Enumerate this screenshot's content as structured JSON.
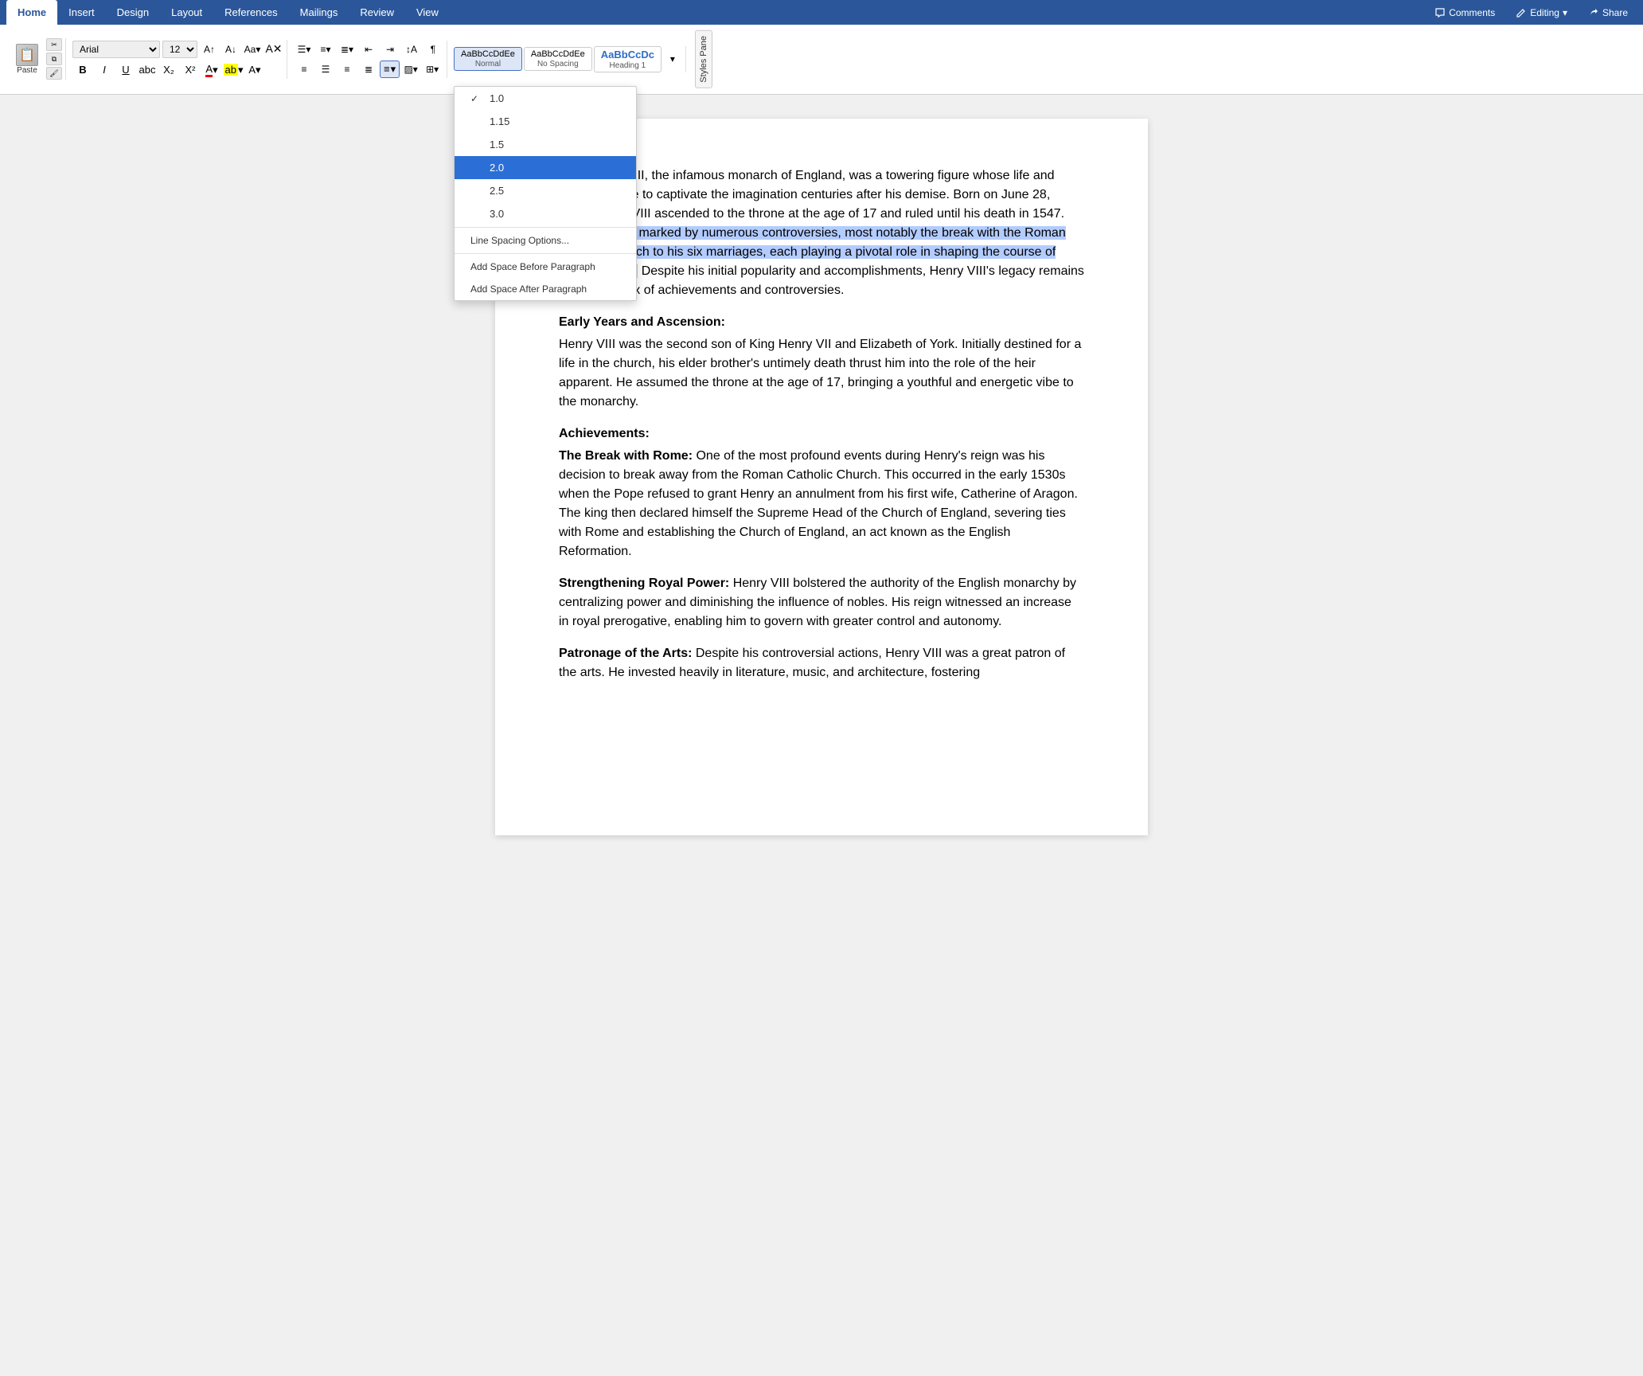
{
  "tabs": {
    "items": [
      {
        "label": "Home",
        "active": true
      },
      {
        "label": "Insert",
        "active": false
      },
      {
        "label": "Design",
        "active": false
      },
      {
        "label": "Layout",
        "active": false
      },
      {
        "label": "References",
        "active": false
      },
      {
        "label": "Mailings",
        "active": false
      },
      {
        "label": "Review",
        "active": false
      },
      {
        "label": "View",
        "active": false
      }
    ]
  },
  "ribbon_right": {
    "comments_label": "Comments",
    "editing_label": "Editing",
    "share_label": "Share"
  },
  "toolbar": {
    "paste_label": "Paste",
    "font_name": "Arial",
    "font_size": "12",
    "bold": "B",
    "italic": "I",
    "underline": "U"
  },
  "styles": [
    {
      "label": "Normal",
      "preview": "AaBbCcDdEe",
      "active": true
    },
    {
      "label": "No Spacing",
      "preview": "AaBbCcDdEe",
      "active": false
    },
    {
      "label": "Heading 1",
      "preview": "AaBbCcDc",
      "active": false
    }
  ],
  "styles_pane_label": "Styles Pane",
  "linespacing": {
    "dropdown_label": "Line Spacing",
    "options": [
      {
        "value": "1.0",
        "label": "1.0",
        "checked": true,
        "selected": false
      },
      {
        "value": "1.15",
        "label": "1.15",
        "checked": false,
        "selected": false
      },
      {
        "value": "1.5",
        "label": "1.5",
        "checked": false,
        "selected": false
      },
      {
        "value": "2.0",
        "label": "2.0",
        "checked": false,
        "selected": true
      },
      {
        "value": "2.5",
        "label": "2.5",
        "checked": false,
        "selected": false
      },
      {
        "value": "3.0",
        "label": "3.0",
        "checked": false,
        "selected": false
      }
    ],
    "options_link": "Line Spacing Options...",
    "add_before": "Add Space Before Paragraph",
    "add_after": "Add Space After Paragraph"
  },
  "document": {
    "para1": "King Henry VIII, the infamous monarch of England, was a towering figure whose life and reign continue to captivate the imagination centuries after his demise. Born on June 28, 1491, Henry VIII ascended to the throne at the age of 17 and ruled until his death in 1547. His reign was marked by numerous controversies, most notably the break with the Roman Catholic Church to his six marriages, each playing a pivotal role in shaping the course of British history. Despite his initial popularity and accomplishments, Henry VIII's legacy remains a complex mix of achievements and controversies.",
    "heading1": "Early Years and Ascension:",
    "para2": "Henry VIII was the second son of King Henry VII and Elizabeth of York. Initially destined for a life in the church, his elder brother's untimely death thrust him into the role of the heir apparent. He assumed the throne at the age of 17, bringing a youthful and energetic vibe to the monarchy.",
    "heading2": "Achievements:",
    "heading3": "The Break with Rome:",
    "para3": "One of the most profound events during Henry's reign was his decision to break away from the Roman Catholic Church. This occurred in the early 1530s when the Pope refused to grant Henry an annulment from his first wife, Catherine of Aragon. The king then declared himself the Supreme Head of the Church of England, severing ties with Rome and establishing the Church of England, an act known as the English Reformation.",
    "heading4": "Strengthening Royal Power:",
    "para4": "Henry VIII bolstered the authority of the English monarchy by centralizing power and diminishing the influence of nobles. His reign witnessed an increase in royal prerogative, enabling him to govern with greater control and autonomy.",
    "heading5": "Patronage of the Arts:",
    "para5": "Despite his controversial actions, Henry VIII was a great patron of the arts. He invested heavily in literature, music, and architecture, fostering"
  }
}
